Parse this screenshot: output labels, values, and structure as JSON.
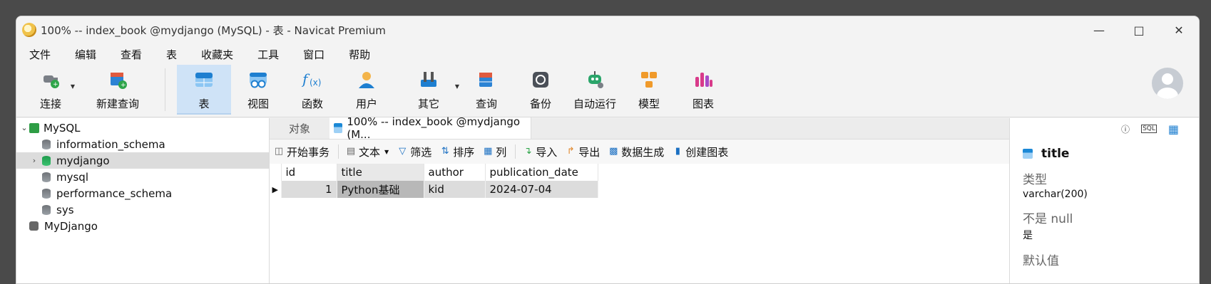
{
  "window": {
    "title": "100% -- index_book @mydjango (MySQL) - 表 - Navicat Premium"
  },
  "menu": [
    "文件",
    "编辑",
    "查看",
    "表",
    "收藏夹",
    "工具",
    "窗口",
    "帮助"
  ],
  "toolbar": {
    "connect": "连接",
    "new_query": "新建查询",
    "table": "表",
    "view": "视图",
    "function": "函数",
    "user": "用户",
    "other": "其它",
    "query": "查询",
    "backup": "备份",
    "automation": "自动运行",
    "model": "模型",
    "chart": "图表"
  },
  "sidebar": {
    "connection": "MySQL",
    "databases": [
      "information_schema",
      "mydjango",
      "mysql",
      "performance_schema",
      "sys"
    ],
    "other_connection": "MyDjango"
  },
  "tabs": {
    "objects": "对象",
    "active": "100% -- index_book @mydjango (M..."
  },
  "subtoolbar": {
    "begin_tx": "开始事务",
    "text": "文本",
    "filter": "筛选",
    "sort": "排序",
    "columns": "列",
    "import": "导入",
    "export": "导出",
    "data_gen": "数据生成",
    "create_chart": "创建图表"
  },
  "grid": {
    "headers": [
      "id",
      "title",
      "author",
      "publication_date"
    ],
    "rows": [
      [
        "1",
        "Python基础",
        "kid",
        "2024-07-04"
      ]
    ]
  },
  "details": {
    "field": "title",
    "type_label": "类型",
    "type_value": "varchar(200)",
    "notnull_label": "不是 null",
    "notnull_value": "是",
    "default_label": "默认值"
  }
}
